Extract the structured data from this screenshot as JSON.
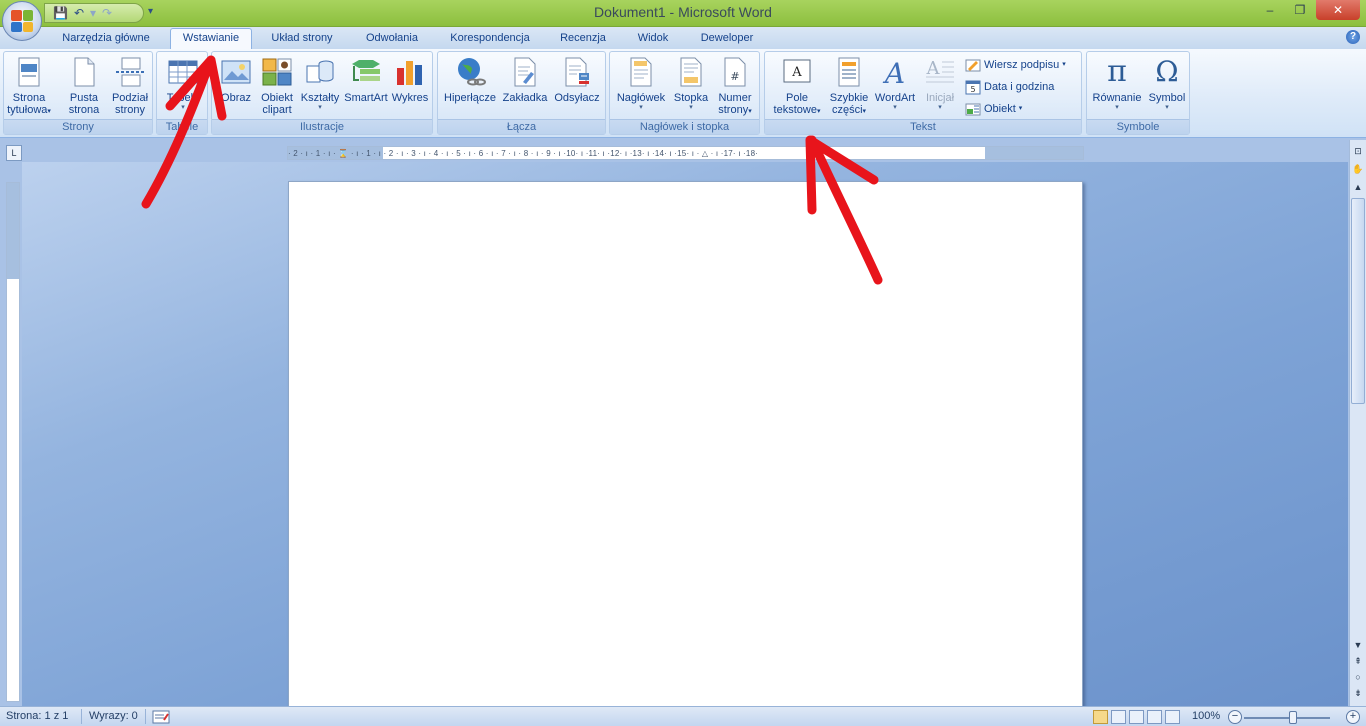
{
  "window": {
    "title": "Dokument1 - Microsoft Word",
    "controls": {
      "minimize": "–",
      "maximize": "❐",
      "close": "✕"
    }
  },
  "qat": {
    "save": "💾",
    "undo": "↶",
    "undo_arrow": "▾",
    "redo": "↷",
    "more": "▾"
  },
  "tabs": [
    {
      "label": "Narzędzia główne"
    },
    {
      "label": "Wstawianie",
      "active": true
    },
    {
      "label": "Układ strony"
    },
    {
      "label": "Odwołania"
    },
    {
      "label": "Korespondencja"
    },
    {
      "label": "Recenzja"
    },
    {
      "label": "Widok"
    },
    {
      "label": "Deweloper"
    }
  ],
  "help": "?",
  "ribbon": {
    "strony": {
      "label": "Strony",
      "buttons": [
        {
          "label1": "Strona",
          "label2": "tytułowa",
          "dropdown": "▾"
        },
        {
          "label1": "Pusta",
          "label2": "strona"
        },
        {
          "label1": "Podział",
          "label2": "strony"
        }
      ]
    },
    "tabele": {
      "label": "Tabele",
      "button": {
        "label1": "Tabela",
        "dropdown": "▾"
      }
    },
    "ilustracje": {
      "label": "Ilustracje",
      "buttons": [
        {
          "label1": "Obraz"
        },
        {
          "label1": "Obiekt",
          "label2": "clipart"
        },
        {
          "label1": "Kształty",
          "dropdown": "▾"
        },
        {
          "label1": "SmartArt"
        },
        {
          "label1": "Wykres"
        }
      ]
    },
    "lacza": {
      "label": "Łącza",
      "buttons": [
        {
          "label1": "Hiperłącze"
        },
        {
          "label1": "Zakładka"
        },
        {
          "label1": "Odsyłacz"
        }
      ]
    },
    "naglowek": {
      "label": "Nagłówek i stopka",
      "buttons": [
        {
          "label1": "Nagłówek",
          "dropdown": "▾"
        },
        {
          "label1": "Stopka",
          "dropdown": "▾"
        },
        {
          "label1": "Numer",
          "label2": "strony",
          "dropdown": "▾"
        }
      ]
    },
    "tekst": {
      "label": "Tekst",
      "buttons": [
        {
          "label1": "Pole",
          "label2": "tekstowe",
          "dropdown": "▾"
        },
        {
          "label1": "Szybkie",
          "label2": "części",
          "dropdown": "▾"
        },
        {
          "label1": "WordArt",
          "dropdown": "▾"
        },
        {
          "label1": "Inicjał",
          "dropdown": "▾",
          "disabled": true
        }
      ],
      "small": [
        {
          "label": "Wiersz podpisu",
          "dropdown": "▾"
        },
        {
          "label": "Data i godzina"
        },
        {
          "label": "Obiekt",
          "dropdown": "▾"
        }
      ]
    },
    "symbole": {
      "label": "Symbole",
      "buttons": [
        {
          "label1": "Równanie",
          "dropdown": "▾",
          "glyph": "π"
        },
        {
          "label1": "Symbol",
          "dropdown": "▾",
          "glyph": "Ω"
        }
      ]
    }
  },
  "ruler": {
    "corner": "L",
    "horizontal": "· 2 · ı · 1 · ı · ⌛ · ı · 1 · ı · 2 · ı · 3 · ı · 4 · ı · 5 · ı · 6 · ı · 7 · ı · 8 · ı · 9 · ı ·10· ı ·11· ı ·12· ı ·13· ı ·14· ı ·15· ı · △ · ı ·17· ı ·18·"
  },
  "scrollbar": {
    "up": "▲",
    "down": "▼",
    "prev": "⇞",
    "browse": "○",
    "next": "⇟",
    "ruler_toggle": "⊡",
    "pan": "✋",
    "split": "≡"
  },
  "status": {
    "page": "Strona: 1 z 1",
    "words": "Wyrazy: 0",
    "zoom": "100%",
    "zoom_minus": "−",
    "zoom_plus": "+"
  },
  "colors": {
    "titlebar": "#9ccb52",
    "accent": "#15428b",
    "annotation": "#e8141b"
  }
}
